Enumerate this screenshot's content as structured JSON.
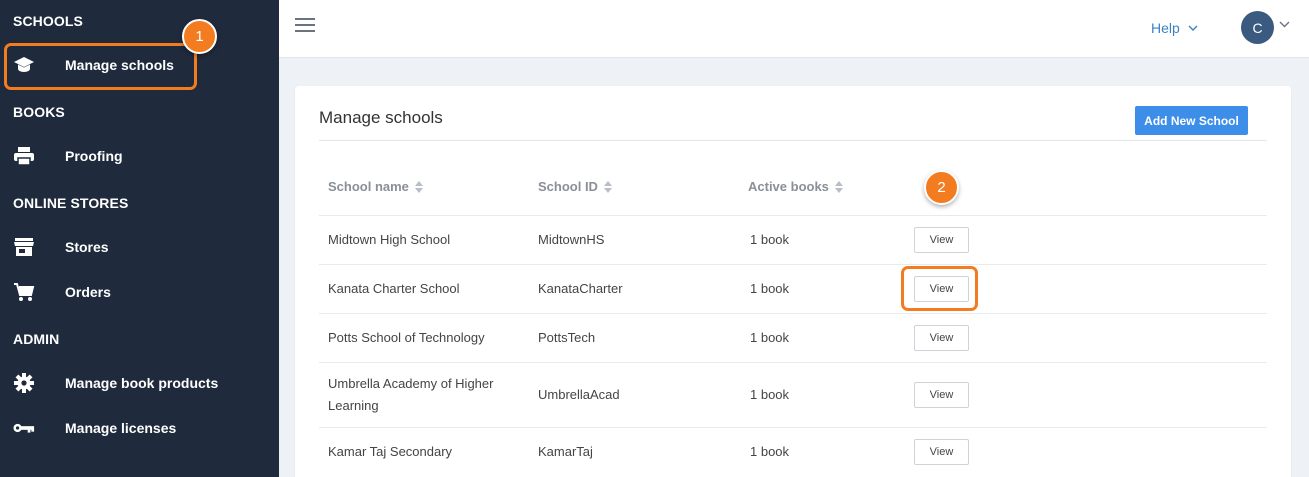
{
  "sidebar": {
    "sections": [
      {
        "title": "SCHOOLS"
      },
      {
        "title": "BOOKS"
      },
      {
        "title": "ONLINE STORES"
      },
      {
        "title": "ADMIN"
      }
    ],
    "items": [
      {
        "label": "Manage schools",
        "icon": "graduation-cap-icon"
      },
      {
        "label": "Proofing",
        "icon": "printer-icon"
      },
      {
        "label": "Stores",
        "icon": "store-icon"
      },
      {
        "label": "Orders",
        "icon": "cart-icon"
      },
      {
        "label": "Manage book products",
        "icon": "gear-icon"
      },
      {
        "label": "Manage licenses",
        "icon": "key-icon"
      }
    ]
  },
  "topbar": {
    "help_label": "Help",
    "avatar_initial": "C"
  },
  "main": {
    "title": "Manage schools",
    "add_button_label": "Add New School",
    "columns": [
      "School name",
      "School ID",
      "Active books"
    ],
    "rows": [
      {
        "name": "Midtown High School",
        "id": "MidtownHS",
        "books": "1 book",
        "action": "View"
      },
      {
        "name": "Kanata Charter School",
        "id": "KanataCharter",
        "books": "1 book",
        "action": "View"
      },
      {
        "name": "Potts School of Technology",
        "id": "PottsTech",
        "books": "1 book",
        "action": "View"
      },
      {
        "name": "Umbrella Academy of Higher Learning",
        "id": "UmbrellaAcad",
        "books": "1 book",
        "action": "View"
      },
      {
        "name": "Kamar Taj Secondary",
        "id": "KamarTaj",
        "books": "1 book",
        "action": "View"
      }
    ]
  },
  "annotations": {
    "step1": "1",
    "step2": "2",
    "accent_color": "#f47c20"
  },
  "colors": {
    "sidebar_bg": "#1f2a3c",
    "primary": "#3d8ee8"
  }
}
